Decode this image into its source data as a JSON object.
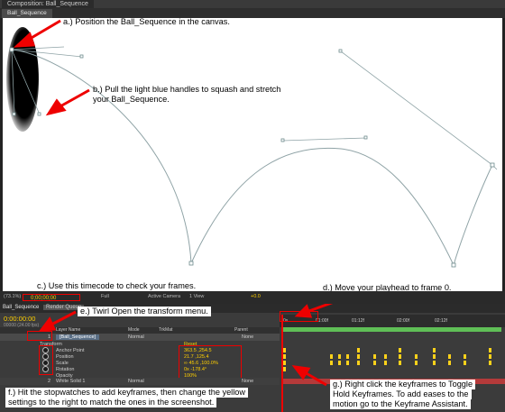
{
  "window": {
    "panel_title": "Composition: Ball_Sequence",
    "comp_tab": "Ball_Sequence"
  },
  "annotations": {
    "a": "a.)  Position the Ball_Sequence in the canvas.",
    "b1": "b.)  Pull the light blue handles to squash and stretch",
    "b2": "your Ball_Sequence.",
    "c": "c.) Use this timecode to check your frames.",
    "d": "d.)  Move your playhead to frame 0.",
    "e": "e.)  Twirl Open the transform menu.",
    "f1": "f.)  Hit the stopwatches to add keyframes, then change the yellow",
    "f2": "settings to the right to match the ones in the screenshot.",
    "g1": "g.)  Right click the keyframes to Toggle",
    "g2": "Hold Keyframes. To add eases to the",
    "g3": "motion go to the Keyframe Assistant."
  },
  "viewer_controls": {
    "zoom": "(73.1%)",
    "timecode": "0;00;00;00",
    "quality": "Full",
    "camera": "Active Camera",
    "views": "1 View",
    "exposure": "+0.0"
  },
  "timeline": {
    "comp_tab": "Ball_Sequence",
    "render_queue_tab": "Render Queue",
    "current_time": "0:00:00:00",
    "fps": "00000 (24.00 fps)",
    "col_layer_name": "Layer Name",
    "col_mode": "Mode",
    "col_trkmat": "TrkMat",
    "col_parent": "Parent",
    "ruler_ticks": [
      "0s",
      "01:00f",
      "01:12f",
      "02:00f",
      "02:12f"
    ],
    "layers": [
      {
        "num": "1",
        "name": "[Ball_Sequence]",
        "mode": "Normal",
        "parent": "None"
      },
      {
        "num": "2",
        "name": "White Solid 1",
        "mode": "Normal",
        "parent": "None"
      }
    ],
    "transform_label": "Transform",
    "reset_label": "Reset",
    "properties": [
      {
        "name": "Anchor Point",
        "value": "363.5 ,254.5"
      },
      {
        "name": "Position",
        "value": "21.7 ,125.4"
      },
      {
        "name": "Scale",
        "value": "∞ 45.6 ,100.0%"
      },
      {
        "name": "Rotation",
        "value": "0x -178.4°"
      },
      {
        "name": "Opacity",
        "value": "100%"
      }
    ]
  },
  "colors": {
    "annotation_red": "#e00000",
    "keyframe_yellow": "#ffd21a",
    "motion_path": "#8fa3a6",
    "playhead_bar": "#5fbf56",
    "timecode_yellow": "#ffd000"
  }
}
